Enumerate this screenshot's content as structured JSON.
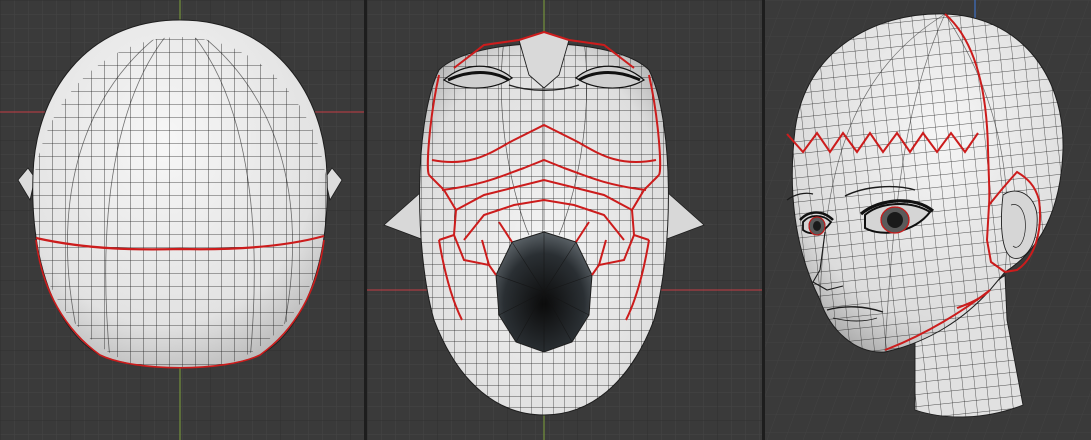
{
  "viewports": [
    {
      "id": "bottom",
      "view": "bottom-orthographic"
    },
    {
      "id": "front",
      "view": "front-orthographic-from-below"
    },
    {
      "id": "persp",
      "view": "user-perspective"
    }
  ],
  "colors": {
    "background": "#3a3a3a",
    "grid_minor": "#444444",
    "grid_major": "#2f2f2f",
    "axis_x": "#c43c44",
    "axis_y": "#7da23a",
    "axis_z": "#3f6fc4",
    "mesh_fill": "#ececec",
    "mesh_shade": "#cfcfcf",
    "wire": "#1a1a1a",
    "seam": "#cc1c1c",
    "divider": "#1d1d1d"
  },
  "icons": [
    "wireframe-mesh",
    "uv-seam"
  ]
}
